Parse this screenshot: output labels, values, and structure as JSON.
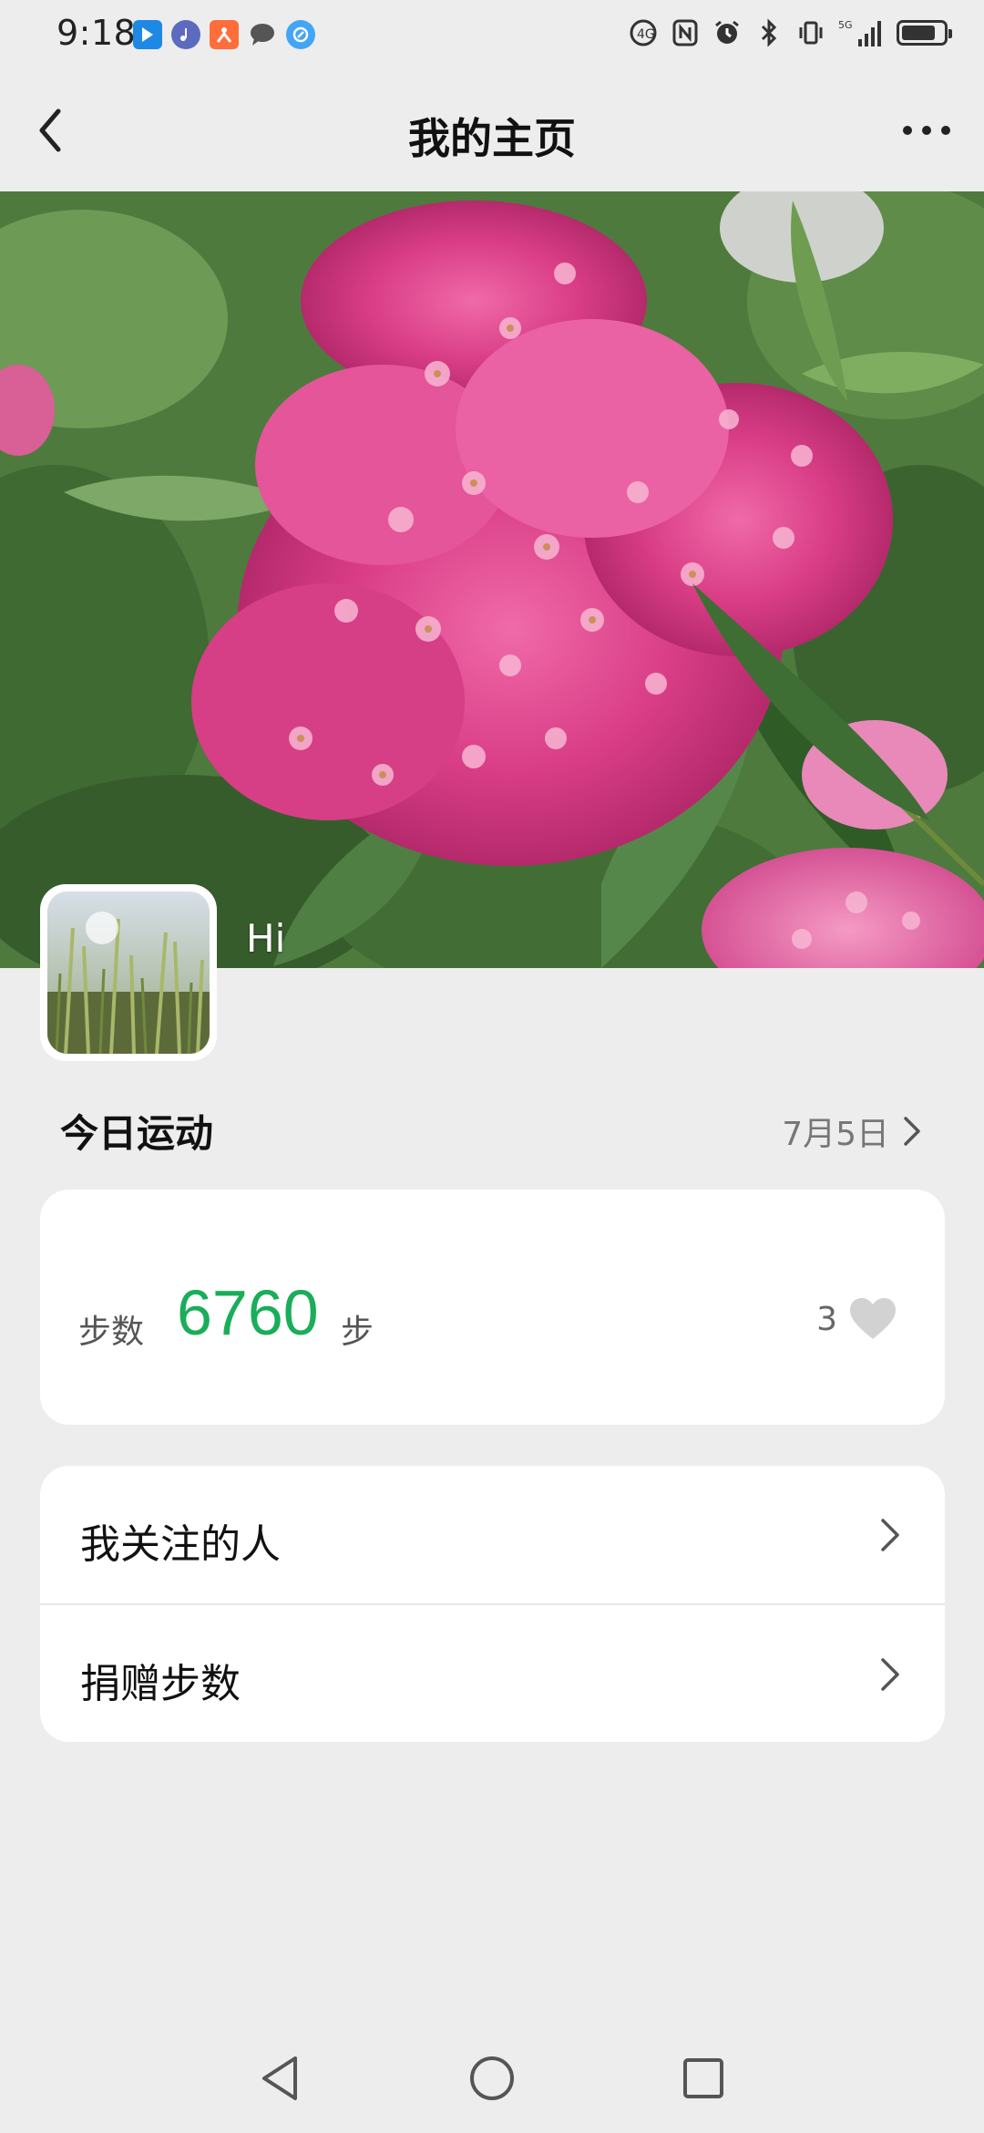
{
  "status_bar": {
    "time": "9:18",
    "network_label": "5G"
  },
  "header": {
    "title": "我的主页"
  },
  "profile": {
    "greeting": "Hi"
  },
  "today": {
    "title": "今日运动",
    "date": "7月5日"
  },
  "steps": {
    "label": "步数",
    "value": "6760",
    "unit": "步",
    "likes": "3"
  },
  "menu": {
    "items": [
      {
        "label": "我关注的人"
      },
      {
        "label": "捐赠步数"
      }
    ]
  },
  "colors": {
    "accent": "#1aad5a",
    "background": "#ededed",
    "card": "#ffffff"
  },
  "icons": {
    "back": "chevron-left-icon",
    "more": "more-dots-icon",
    "like": "heart-icon",
    "chevron": "chevron-right-icon"
  }
}
